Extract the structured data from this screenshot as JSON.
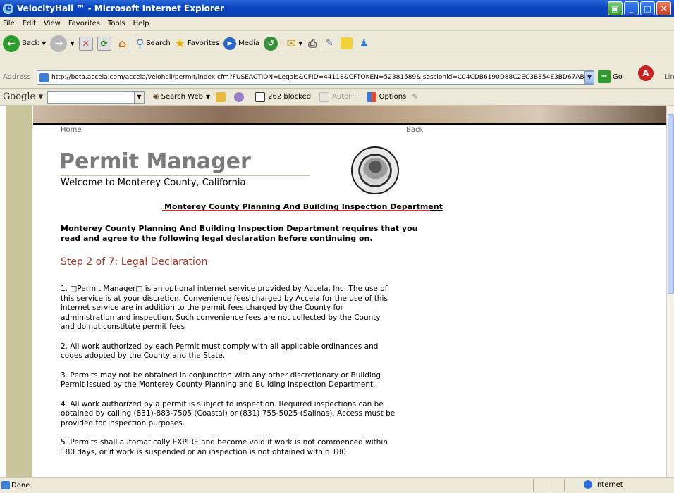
{
  "window": {
    "title": "VelocityHall ™ - Microsoft Internet Explorer"
  },
  "menu": [
    "File",
    "Edit",
    "View",
    "Favorites",
    "Tools",
    "Help"
  ],
  "toolbar": {
    "back": "Back",
    "search": "Search",
    "favorites": "Favorites",
    "media": "Media"
  },
  "address": {
    "label": "Address",
    "url": "http://beta.accela.com/accela/velohall/permit/index.cfm?FUSEACTION=Legals&CFID=44118&CFTOKEN=52381589&jsessionid=C04CDB6190D88C2EC3B854E3BD67AB",
    "go": "Go",
    "links": "Lin"
  },
  "google": {
    "logo": "Google",
    "search_web": "Search Web",
    "blocked": "262 blocked",
    "autofill": "AutoFill",
    "options": "Options"
  },
  "nav": {
    "home": "Home",
    "back": "Back"
  },
  "app": {
    "name": "Permit Manager",
    "welcome": "Welcome to Monterey County, California"
  },
  "department": "Monterey County Planning And Building Inspection Department",
  "intro": "Monterey County Planning And Building Inspection Department requires that you read and agree to the following legal declaration before continuing on.",
  "step": "Step 2 of 7: Legal Declaration",
  "terms": [
    "1. □Permit Manager□ is an optional internet service provided by Accela, Inc. The use of this service is at your discretion. Convenience fees charged by Accela for the use of this internet service are in addition to the permit fees charged by the County for administration and inspection. Such convenience fees are not collected by the County and do not constitute permit fees",
    "2. All work authorized by each Permit must comply with all applicable ordinances and codes adopted by the County and the State.",
    "3. Permits may not be obtained in conjunction with any other discretionary or Building Permit issued by the Monterey County Planning and Building Inspection Department.",
    "4. All work authorized by a permit is subject to inspection. Required inspections can be obtained by calling (831)-883-7505 (Coastal) or (831) 755-5025 (Salinas). Access must be provided for inspection purposes.",
    "5. Permits shall automatically EXPIRE and become void if work is not commenced within 180 days, or if work is suspended or an inspection is not obtained within 180"
  ],
  "status": {
    "left": "Done",
    "zone": "Internet"
  }
}
